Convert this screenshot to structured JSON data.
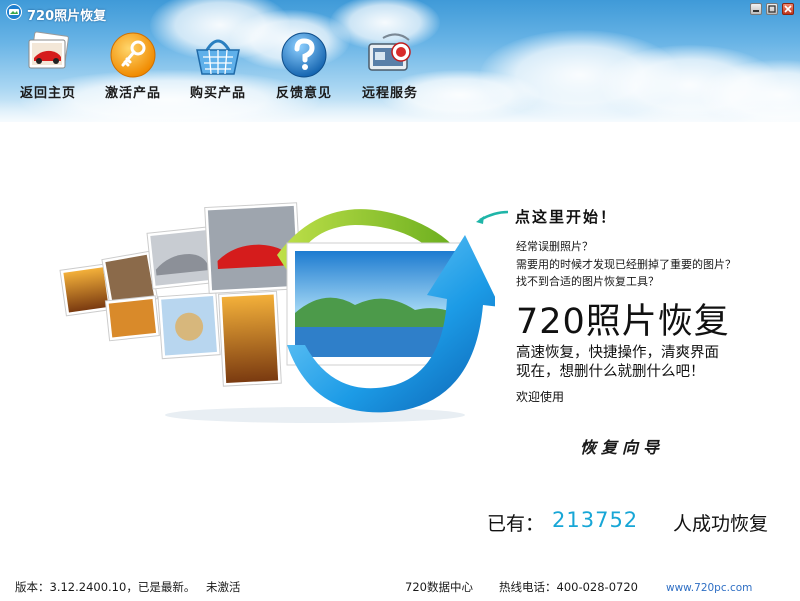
{
  "window": {
    "title": "720照片恢复"
  },
  "nav": [
    {
      "label": "返回主页",
      "icon": "home-photo-icon"
    },
    {
      "label": "激活产品",
      "icon": "key-icon"
    },
    {
      "label": "购买产品",
      "icon": "shopping-basket-icon"
    },
    {
      "label": "反馈意见",
      "icon": "help-question-icon"
    },
    {
      "label": "远程服务",
      "icon": "remote-service-icon"
    }
  ],
  "main": {
    "click_here": "点这里开始！",
    "descriptions": [
      "经常误删照片？",
      "需要用的时候才发现已经删掉了重要的图片？",
      "找不到合适的图片恢复工具？"
    ],
    "product_name": "720照片恢复",
    "slogan": [
      "高速恢复，快捷操作，清爽界面",
      "现在，想删什么就删什么吧！"
    ],
    "welcome": "欢迎使用",
    "wizard_label": "恢复向导",
    "counter": {
      "prefix": "已有：",
      "value": "213752",
      "suffix": "人成功恢复"
    }
  },
  "status": {
    "version": "版本：3.12.2400.10，已是最新。",
    "activation": "未激活",
    "data_center": "720数据中心",
    "hotline": "热线电话：400-028-0720",
    "website": "www.720pc.com"
  },
  "colors": {
    "accent": "#17a6d6",
    "link": "#2f6fc4",
    "header_sky": "#3f9ad8"
  }
}
